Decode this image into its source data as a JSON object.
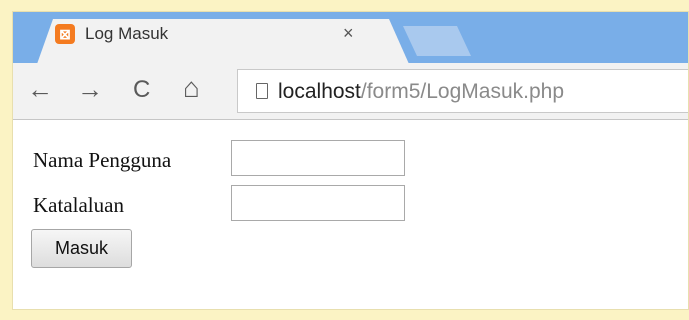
{
  "browser": {
    "tab": {
      "title": "Log Masuk",
      "favicon_glyph": "⊠",
      "close_glyph": "×"
    },
    "nav": {
      "back": "←",
      "forward": "→",
      "reload": "C",
      "home": "⌂"
    },
    "address": {
      "host": "localhost",
      "path": "/form5/LogMasuk.php"
    }
  },
  "form": {
    "username_label": "Nama Pengguna",
    "username_value": "",
    "password_label": "Katalaluan",
    "password_value": "",
    "submit_label": "Masuk"
  }
}
